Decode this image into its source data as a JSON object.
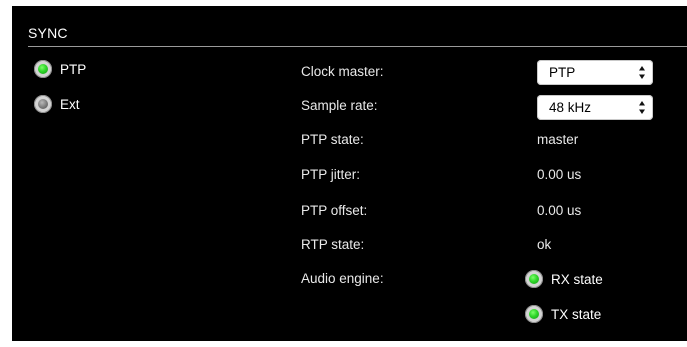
{
  "sync": {
    "title": "SYNC",
    "sources": [
      {
        "label": "PTP",
        "state": "active",
        "color": "#2fd62a"
      },
      {
        "label": "Ext",
        "state": "inactive",
        "color": "#7a7a7a"
      }
    ],
    "fields": {
      "clock_master": {
        "label": "Clock master:",
        "value": "PTP"
      },
      "sample_rate": {
        "label": "Sample rate:",
        "value": "48 kHz"
      },
      "ptp_state": {
        "label": "PTP state:",
        "value": "master"
      },
      "ptp_jitter": {
        "label": "PTP jitter:",
        "value": "0.00 us"
      },
      "ptp_offset": {
        "label": "PTP offset:",
        "value": "0.00 us"
      },
      "rtp_state": {
        "label": "RTP state:",
        "value": "ok"
      },
      "audio_engine": {
        "label": "Audio engine:",
        "rx_state": {
          "label": "RX state",
          "color": "#2fd62a"
        },
        "tx_state": {
          "label": "TX state",
          "color": "#2fd62a"
        }
      }
    }
  }
}
